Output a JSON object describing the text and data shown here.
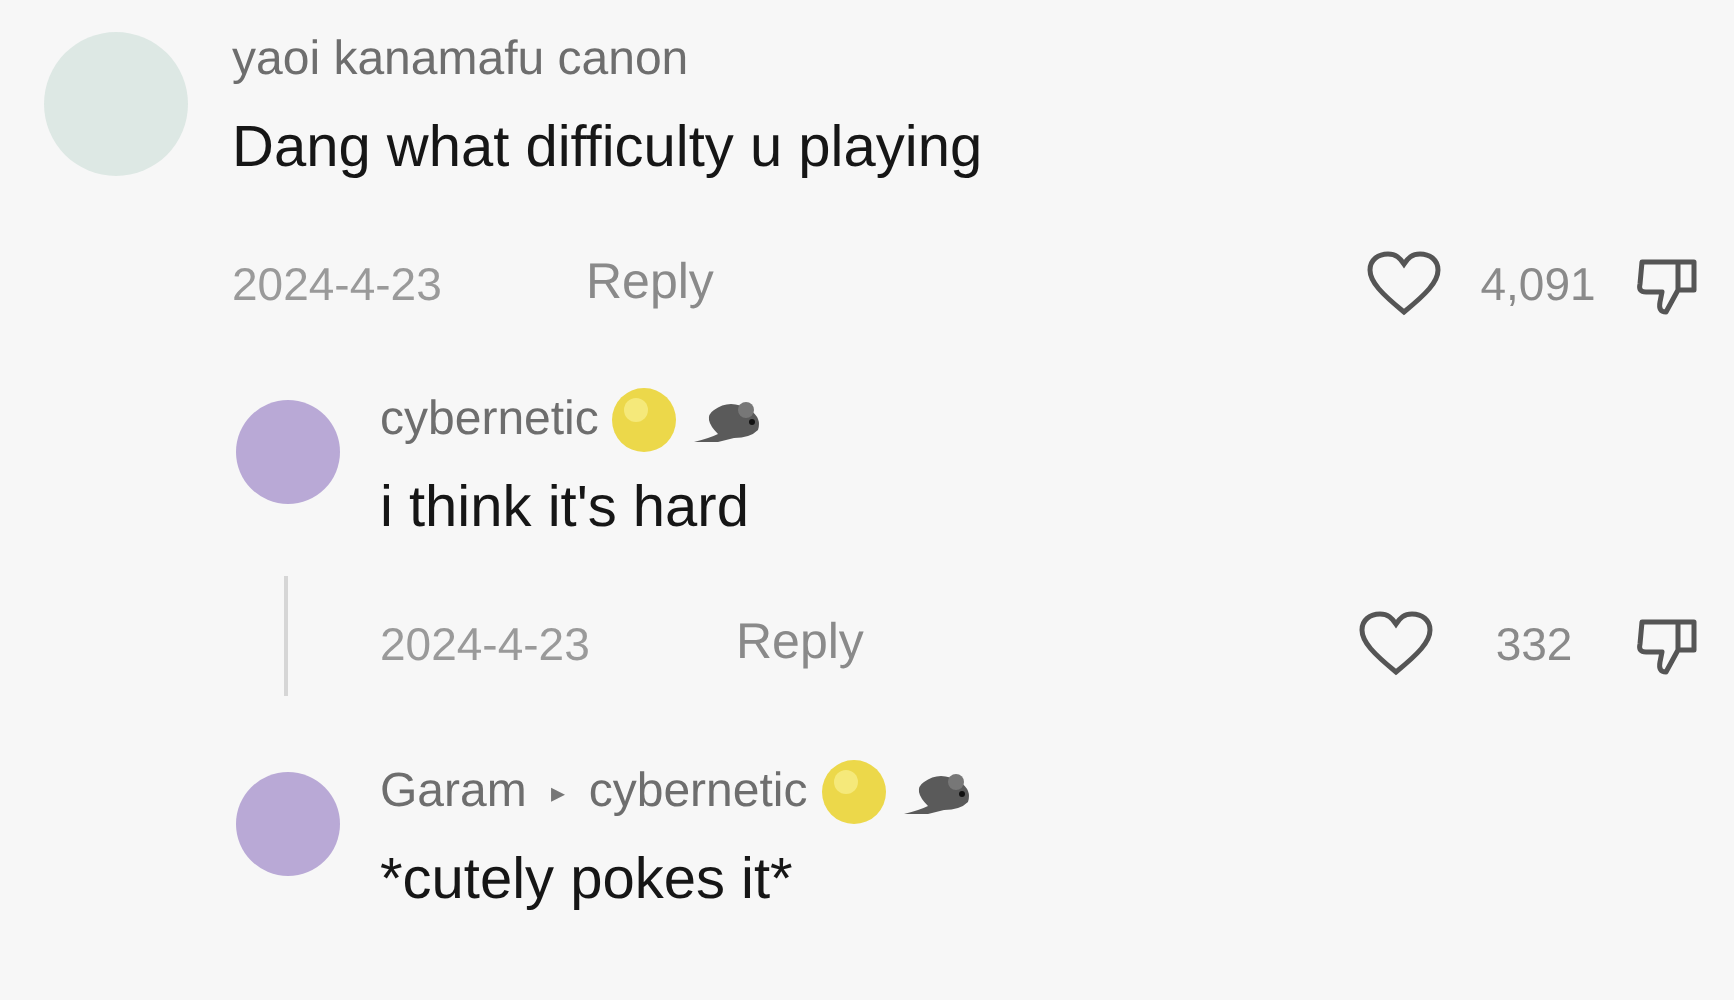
{
  "comments": [
    {
      "author": "yaoi kanamafu canon",
      "badges": false,
      "text": "Dang what difficulty u playing",
      "date": "2024-4-23",
      "reply_label": "Reply",
      "likes": "4,091",
      "liked": false,
      "thread_line": false,
      "children": [
        {
          "author": "cybernetic",
          "badges": true,
          "text": "i think it's hard",
          "date": "2024-4-23",
          "reply_label": "Reply",
          "likes": "332",
          "liked": false,
          "thread_line": true
        },
        {
          "author": "Garam",
          "reply_to": {
            "arrow": "▸",
            "name": "cybernetic",
            "badges": true
          },
          "badges": false,
          "text": "*cutely pokes it*",
          "thread_line": false
        }
      ]
    }
  ]
}
